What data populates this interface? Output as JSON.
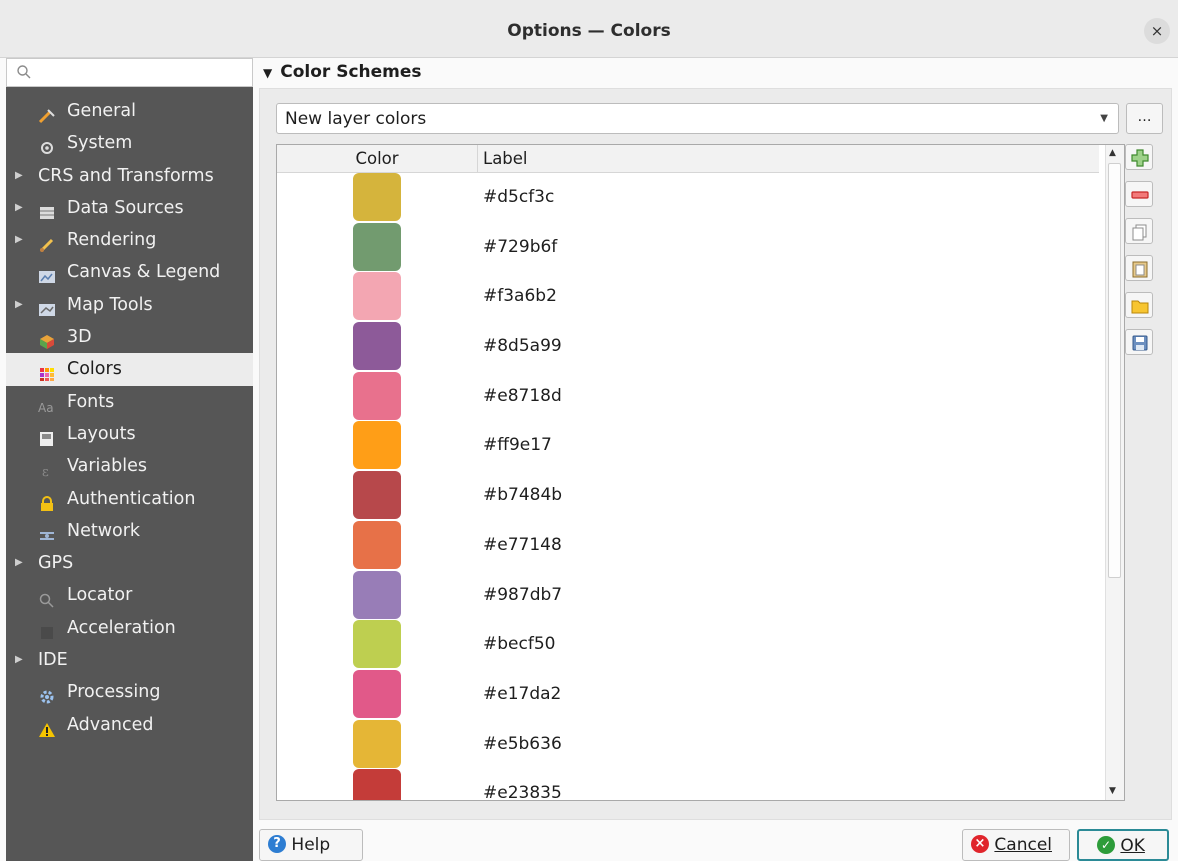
{
  "window": {
    "title": "Options — Colors",
    "close_symbol": "×"
  },
  "search": {
    "placeholder": ""
  },
  "nav": [
    {
      "label": "General",
      "icon": "general-icon",
      "expandable": false
    },
    {
      "label": "System",
      "icon": "system-icon",
      "expandable": false
    },
    {
      "label": "CRS and Transforms",
      "icon": "",
      "expandable": true
    },
    {
      "label": "Data Sources",
      "icon": "data-sources-icon",
      "expandable": true
    },
    {
      "label": "Rendering",
      "icon": "rendering-icon",
      "expandable": true
    },
    {
      "label": "Canvas & Legend",
      "icon": "canvas-legend-icon",
      "expandable": false
    },
    {
      "label": "Map Tools",
      "icon": "map-tools-icon",
      "expandable": true
    },
    {
      "label": "3D",
      "icon": "3d-icon",
      "expandable": false
    },
    {
      "label": "Colors",
      "icon": "colors-icon",
      "expandable": false,
      "selected": true
    },
    {
      "label": "Fonts",
      "icon": "fonts-icon",
      "expandable": false
    },
    {
      "label": "Layouts",
      "icon": "layouts-icon",
      "expandable": false
    },
    {
      "label": "Variables",
      "icon": "variables-icon",
      "expandable": false
    },
    {
      "label": "Authentication",
      "icon": "lock-icon",
      "expandable": false
    },
    {
      "label": "Network",
      "icon": "network-icon",
      "expandable": false
    },
    {
      "label": "GPS",
      "icon": "",
      "expandable": true
    },
    {
      "label": "Locator",
      "icon": "search-icon",
      "expandable": false
    },
    {
      "label": "Acceleration",
      "icon": "acceleration-icon",
      "expandable": false
    },
    {
      "label": "IDE",
      "icon": "",
      "expandable": true
    },
    {
      "label": "Processing",
      "icon": "processing-gear-icon",
      "expandable": false
    },
    {
      "label": "Advanced",
      "icon": "warning-icon",
      "expandable": false
    }
  ],
  "section": {
    "title": "Color Schemes"
  },
  "scheme": {
    "selected": "New layer colors",
    "more_label": "…"
  },
  "table": {
    "headers": {
      "color": "Color",
      "label": "Label"
    },
    "rows": [
      {
        "color": "#d5b43c",
        "label": "#d5cf3c"
      },
      {
        "color": "#729b6f",
        "label": "#729b6f"
      },
      {
        "color": "#f3a6b2",
        "label": "#f3a6b2"
      },
      {
        "color": "#8d5a99",
        "label": "#8d5a99"
      },
      {
        "color": "#e8718d",
        "label": "#e8718d"
      },
      {
        "color": "#ff9e17",
        "label": "#ff9e17"
      },
      {
        "color": "#b7484b",
        "label": "#b7484b"
      },
      {
        "color": "#e77148",
        "label": "#e77148"
      },
      {
        "color": "#987db7",
        "label": "#987db7"
      },
      {
        "color": "#becf50",
        "label": "#becf50"
      },
      {
        "color": "#e15989",
        "label": "#e17da2"
      },
      {
        "color": "#e5b636",
        "label": "#e5b636"
      },
      {
        "color": "#c43c39",
        "label": "#e23835"
      }
    ]
  },
  "side_buttons": [
    "add-color-icon",
    "remove-color-icon",
    "copy-colors-icon",
    "paste-colors-icon",
    "import-colors-icon",
    "export-colors-icon"
  ],
  "footer": {
    "help": "Help",
    "cancel": "Cancel",
    "ok": "OK"
  },
  "colors": {
    "sidebar": "#565656",
    "selected_bg": "#ececec",
    "accent": "#2b8a96"
  }
}
